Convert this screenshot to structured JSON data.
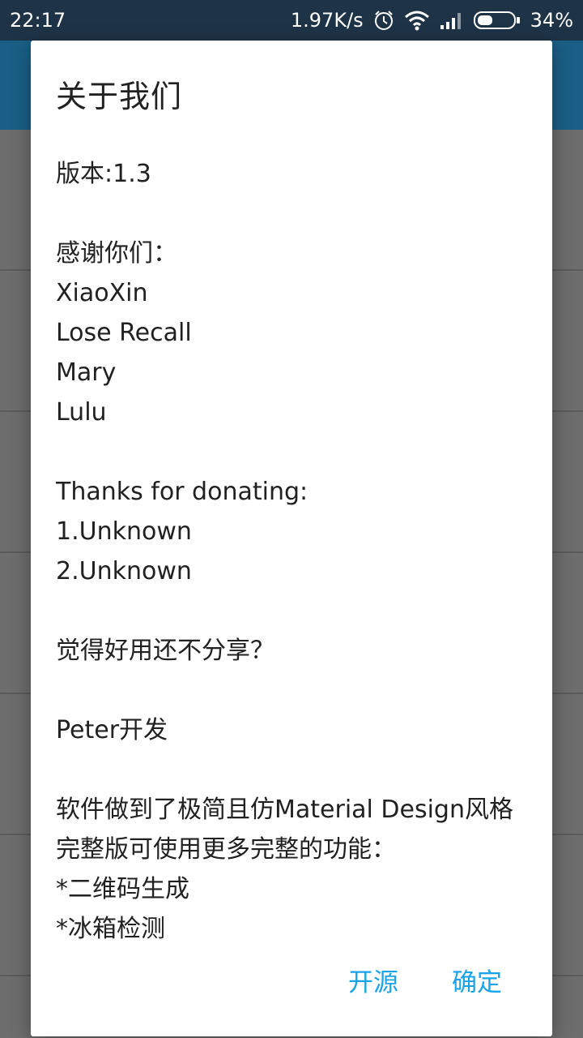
{
  "status_bar": {
    "time": "22:17",
    "net_speed": "1.97K/s",
    "battery_pct": "34%",
    "icons": [
      "alarm-icon",
      "wifi-icon",
      "signal-icon",
      "battery-icon"
    ]
  },
  "dialog": {
    "title": "关于我们",
    "lines": [
      "版本:1.3",
      "",
      "感谢你们：",
      "XiaoXin",
      "Lose Recall",
      "Mary",
      "Lulu",
      "",
      "Thanks for donating:",
      "1.Unknown",
      "2.Unknown",
      "",
      "觉得好用还不分享？",
      "",
      "Peter开发",
      "",
      "软件做到了极简且仿Material Design风格",
      "完整版可使用更多完整的功能：",
      "*二维码生成",
      "*冰箱检测"
    ],
    "buttons": {
      "open_source": "开源",
      "confirm": "确定"
    }
  },
  "colors": {
    "status_bar": "#1e3346",
    "app_bar": "#1b5f86",
    "scrim": "#6d6d6d",
    "accent": "#1aa3e8"
  }
}
